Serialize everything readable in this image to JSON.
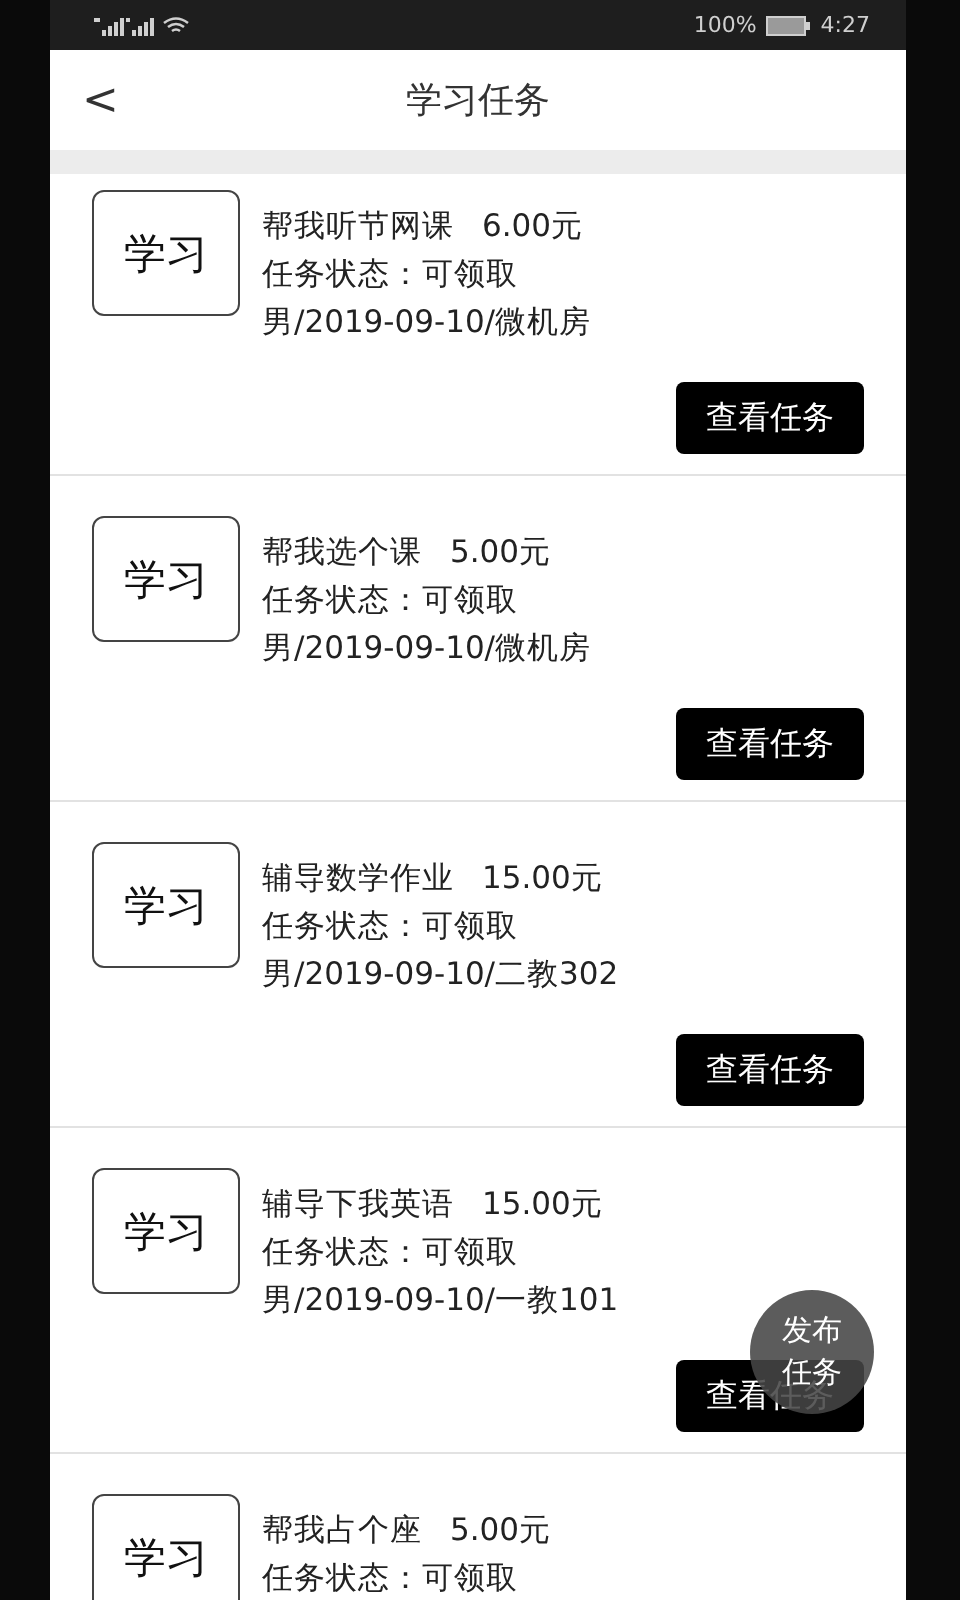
{
  "status_bar": {
    "battery": "100%",
    "time": "4:27"
  },
  "header": {
    "back": "<",
    "title": "学习任务"
  },
  "tasks": [
    {
      "category": "学习",
      "title": "帮我听节网课",
      "price": "6.00元",
      "status": "任务状态：可领取",
      "meta": "男/2019-09-10/微机房",
      "button": "查看任务"
    },
    {
      "category": "学习",
      "title": "帮我选个课",
      "price": "5.00元",
      "status": "任务状态：可领取",
      "meta": "男/2019-09-10/微机房",
      "button": "查看任务"
    },
    {
      "category": "学习",
      "title": "辅导数学作业",
      "price": "15.00元",
      "status": "任务状态：可领取",
      "meta": "男/2019-09-10/二教302",
      "button": "查看任务"
    },
    {
      "category": "学习",
      "title": "辅导下我英语",
      "price": "15.00元",
      "status": "任务状态：可领取",
      "meta": "男/2019-09-10/一教101",
      "button": "查看任务"
    },
    {
      "category": "学习",
      "title": "帮我占个座",
      "price": "5.00元",
      "status": "任务状态：可领取"
    }
  ],
  "fab": {
    "label": "发布任务"
  }
}
